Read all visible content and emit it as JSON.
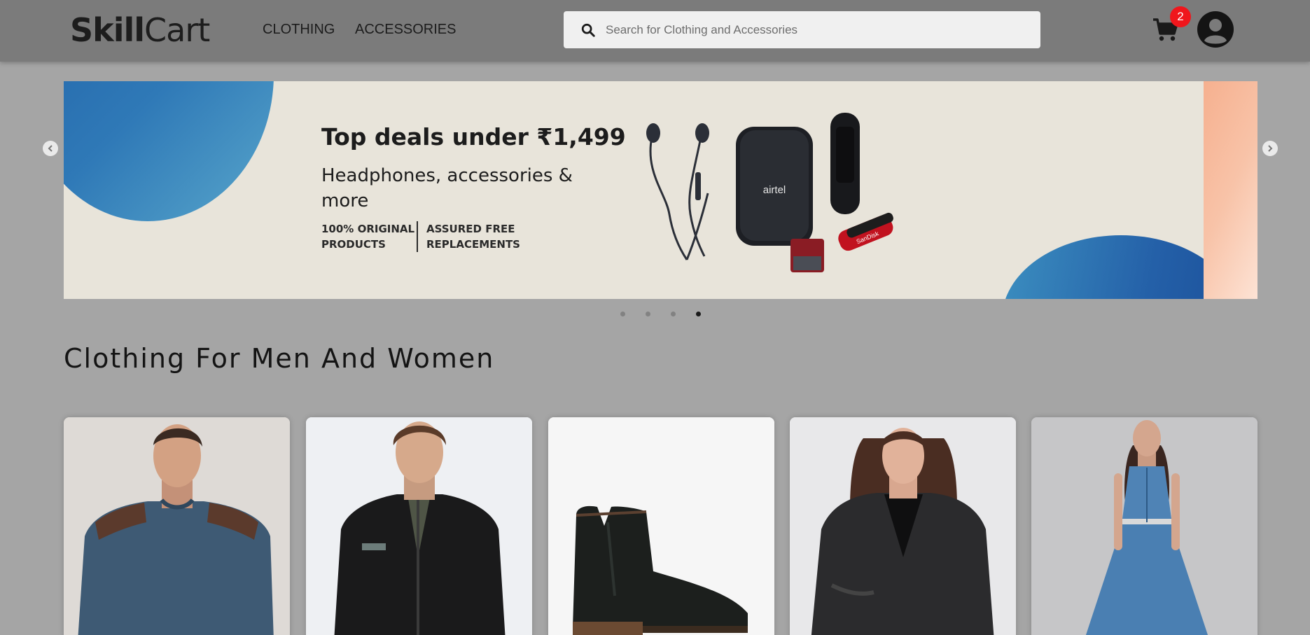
{
  "header": {
    "logo": {
      "part_bold": "Skill",
      "part_regular": "Cart"
    },
    "nav": [
      "CLOTHING",
      "ACCESSORIES"
    ],
    "search": {
      "placeholder": "Search for Clothing and Accessories",
      "value": ""
    },
    "cart_count": "2",
    "icons": [
      "search-icon",
      "cart-icon",
      "user-avatar-icon"
    ]
  },
  "carousel": {
    "banner": {
      "title": "Top deals under ₹1,499",
      "subtitle": "Headphones, accessories & more",
      "features": [
        "100% ORIGINAL PRODUCTS",
        "ASSURED FREE REPLACEMENTS"
      ],
      "product_labels": [
        "airtel",
        "SanDisk"
      ]
    },
    "slide_count": 4,
    "active_index": 3,
    "icons": [
      "chevron-left-icon",
      "chevron-right-icon"
    ]
  },
  "section": {
    "title": "Clothing For Men And Women",
    "products": [
      {
        "name": "blue-sweatshirt"
      },
      {
        "name": "black-jacket"
      },
      {
        "name": "black-chelsea-boot"
      },
      {
        "name": "leather-jacket"
      },
      {
        "name": "blue-denim-dress"
      }
    ]
  },
  "colors": {
    "header_bg": "#7b7b7b",
    "page_bg": "#a5a5a5",
    "badge": "#f0161c",
    "banner_bg": "#e8e4da"
  }
}
